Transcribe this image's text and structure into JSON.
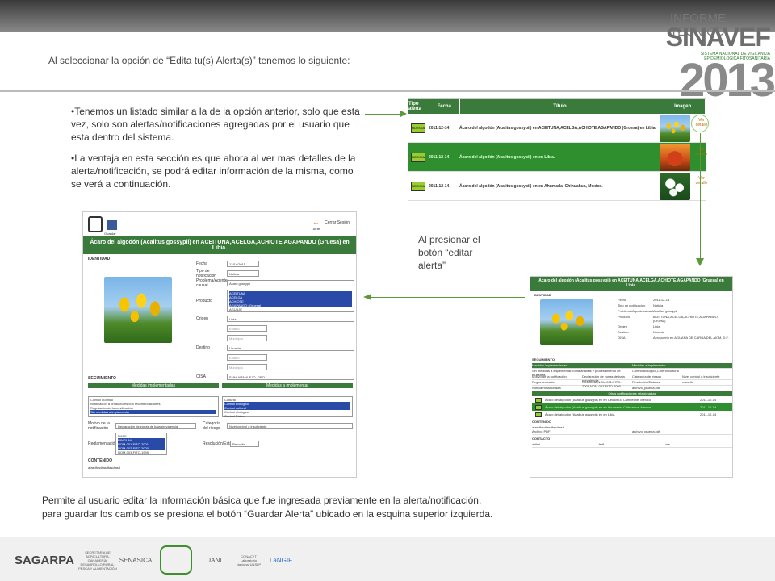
{
  "header": {
    "report_label": "INFORME TECNICO",
    "brand": "SINAVEF",
    "brand_subtitle": "SISTEMA NACIONAL DE VIGILANCIA EPIDEMIOLÓGICA FITOSANITARIA",
    "year": "2013"
  },
  "intro": "Al seleccionar la opción de “Edita tu(s) Alerta(s)” tenemos lo siguiente:",
  "bullets": [
    "•Tenemos un listado similar a la de la opción anterior, solo que esta vez, solo son alertas/notificaciones agregadas por el usuario que esta dentro del sistema.",
    "•La ventaja en esta sección es que ahora al ver mas detalles de la alerta/notificación, se podrá editar información de la misma, como se verá a continuación."
  ],
  "side_note": "Al presionar el botón “editar alerta”",
  "bottom_text": "Permite al usuario editar la información básica que fue ingresada previamente en la alerta/notificación, para guardar los cambios se presiona el botón “Guardar Alerta” ubicado en la esquina superior izquierda.",
  "alert_list": {
    "columns": [
      "Tipo alerta",
      "Fecha",
      "Título",
      "Imagen"
    ],
    "rows": [
      {
        "badge": "NOTICIA",
        "date": "2011-12-14",
        "title": "Ácaro del algodón (Acalitus gossypii) en ACEITUNA,ACELGA,ACHIOTE,AGAPANDO (Gruesa) en Libia.",
        "action": "Ver detalle"
      },
      {
        "badge": "NOTICIA",
        "date": "2011-12-14",
        "title": "Ácaro del algodón (Acalitus gossypii) en en Libia.",
        "action": "Ver detalle"
      },
      {
        "badge": "NOTICIA",
        "date": "2011-12-14",
        "title": "Ácaro del algodón (Acalitus gossypii) en en Ahumada, Chihuahua, Mexico.",
        "action": "Ver detalle"
      }
    ]
  },
  "edit_form": {
    "save_label": "Guardar",
    "close_label": "Cerrar Sesión",
    "back_label": "Atrás",
    "title": "Ácaro del algodón (Acalitus gossypii) en ACEITUNA,ACELGA,ACHIOTE,AGAPANDO (Gruesa) en Libia.",
    "section_identity": "IDENTIDAD",
    "fields": [
      {
        "label": "Fecha",
        "value": "12/14/2011"
      },
      {
        "label": "Tipo de notificación",
        "value": "Noticia"
      },
      {
        "label": "Problema/Agente causal",
        "value": "Acaro gossypii"
      }
    ],
    "product_label": "Producto",
    "product_options": [
      "ACEITUNA",
      "ACELGA",
      "ACHIOTE",
      "AGAPANDO (Gruesa)",
      "AGUAJE"
    ],
    "origin_label": "Origen",
    "origin_value": "Libia",
    "origin_sub1": "Estado",
    "origin_sub2": "Municipio",
    "dest_label": "Destino",
    "dest_value": "Lituania",
    "dest_sub1": "Estado",
    "dest_sub2": "Municipio",
    "oisa_label": "OISA",
    "oisa_value": "EMHUATAHUEJO, GRO.",
    "section_seg": "SEGUIMIENTO",
    "implemented_label": "Medidas implementadas",
    "to_implement_label": "Medidas a implementar",
    "implemented_options": [
      "Control químico",
      "Notificación a productores con recomendaciones",
      "Regulación de la movilización",
      "Sin medidas a implementar"
    ],
    "to_implement_options": [
      "Cultural",
      "Control biológico",
      "Control cultural",
      "Control etológico",
      "Control Físico"
    ],
    "motive_label": "Motivo de la notificación",
    "motive_value": "Declaración de zonas de baja prevalencia",
    "risk_label": "Categoría del riesgo",
    "risk_value": "Nivel control o insuficiente",
    "reg_label": "Reglamentación",
    "reg_options": [
      "NAPF",
      "NINGUNA",
      "NOM-001-FITO-2001",
      "NOM-002-FITO-2000",
      "NOM-003-FITO-1995"
    ],
    "resolution_label": "Resolución/Estatus",
    "resolution_value": "Resuelta",
    "section_content": "CONTENIDO",
    "content_value": "afasdfasdfasdfasdfasd"
  },
  "detail": {
    "title": "Ácaro del algodón (Acalitus gossypii) en ACEITUNA,ACELGA,ACHIOTE,AGAPANDO (Gruesa) en Libia.",
    "section_identity": "IDENTIDAD",
    "fields": [
      {
        "label": "Fecha",
        "value": "2011-12-14"
      },
      {
        "label": "Tipo de notificación",
        "value": "Noticia"
      },
      {
        "label": "Problema/Agente causal",
        "value": "Acalitus gossypii"
      },
      {
        "label": "Producto",
        "value": "ACEITUNA,ACELGA,ACHIOTE,AGAPANDO (Gruesa)"
      },
      {
        "label": "Origen",
        "value": "Libia"
      },
      {
        "label": "Destino",
        "value": "Lituania"
      },
      {
        "label": "OISA",
        "value": "Aeropuerto en AGUANA DE CARGA DEL AICM, D.F."
      }
    ],
    "section_seg": "SEGUIMIENTO",
    "seg_cols": [
      "Medidas implementadas",
      "Medidas a implementar"
    ],
    "seg_rows": [
      [
        "Sin medidas a implementar.Toma análisis y procesamiento de muestras",
        "Control biológico,Control cultural"
      ],
      [
        "Motivo de la notificación",
        "Declaración de zonas de baja prevalencia"
      ],
      [
        "Reglamentación",
        "NINGUNA,NOM-001-FITO-2001,NOM-002-FITO-2000"
      ],
      [
        "Noticia Relacionada",
        "archivo_prueba.pdf"
      ]
    ],
    "risk_label": "Categoría del riesgo",
    "risk_value": "Nivel control o insuficiente",
    "status_label": "Resolución/Estatus",
    "status_value": "resuelta",
    "related_band": "Otras notificaciones relacionadas",
    "related": [
      {
        "title": "Ácaro del algodón (Acalitus gossypii) en en Celakmul, Campeche, Mexico.",
        "date": "2011-12-14"
      },
      {
        "title": "Ácaro del algodón (Acalitus gossypii) en en Ahumada, Chihuahua, Mexico.",
        "date": "2011-12-14"
      },
      {
        "title": "Ácaro del algodón (Acalitus gossypii) en en Libia.",
        "date": "2011-12-14"
      }
    ],
    "section_content": "CONTENIDO",
    "content_value": "afasdfasdfasdfasdfasd",
    "file_label": "Archivo PDF",
    "file_value": "archivo_prueba.pdf",
    "section_contact": "CONTACTO",
    "contact_values": [
      "adfad",
      "fsdf",
      "sfa"
    ]
  },
  "footer": {
    "logos": [
      "SAGARPA",
      "SECRETARÍA DE AGRICULTURA, GANADERÍA, DESARROLLO RURAL, PESCA Y ALIMENTACIÓN",
      "SENASICA",
      "UANL",
      "CONACYT Laboratorio Nacional UNSLP",
      "LaNGIF"
    ]
  }
}
